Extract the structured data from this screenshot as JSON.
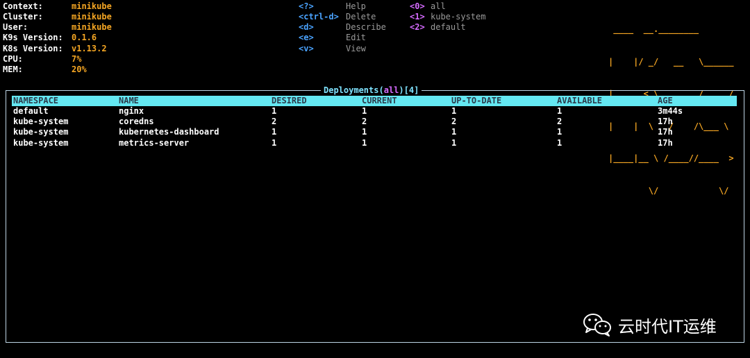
{
  "info": [
    {
      "label": "Context:",
      "value": "minikube"
    },
    {
      "label": "Cluster:",
      "value": "minikube"
    },
    {
      "label": "User:",
      "value": "minikube"
    },
    {
      "label": "K9s Version:",
      "value": "0.1.6"
    },
    {
      "label": "K8s Version:",
      "value": "v1.13.2"
    },
    {
      "label": "CPU:",
      "value": "7%"
    },
    {
      "label": "MEM:",
      "value": "20%"
    }
  ],
  "shortcuts": [
    {
      "key": "<?>",
      "action": "Help"
    },
    {
      "key": "<ctrl-d>",
      "action": "Delete"
    },
    {
      "key": "<d>",
      "action": "Describe"
    },
    {
      "key": "<e>",
      "action": "Edit"
    },
    {
      "key": "<v>",
      "action": "View"
    }
  ],
  "namespaces": [
    {
      "key": "<0>",
      "name": "all"
    },
    {
      "key": "<1>",
      "name": "kube-system"
    },
    {
      "key": "<2>",
      "name": "default"
    }
  ],
  "logo": {
    "line1": " ____  __.________       ",
    "line2": "|    |/ _/   __   \\______",
    "line3": "|      < \\____    /  ___/",
    "line4": "|    |  \\   /    /\\___ \\ ",
    "line5": "|____|__ \\ /____//____  >",
    "line6": "        \\/            \\/ "
  },
  "panel": {
    "title_prefix": "Deployments(",
    "title_scope": "all",
    "title_suffix": ")[4]"
  },
  "table": {
    "headers": [
      "NAMESPACE",
      "NAME",
      "DESIRED",
      "CURRENT",
      "UP-TO-DATE",
      "AVAILABLE",
      "AGE"
    ],
    "rows": [
      [
        "default",
        "nginx",
        "1",
        "1",
        "1",
        "1",
        "3m44s"
      ],
      [
        "kube-system",
        "coredns",
        "2",
        "2",
        "2",
        "2",
        "17h"
      ],
      [
        "kube-system",
        "kubernetes-dashboard",
        "1",
        "1",
        "1",
        "1",
        "17h"
      ],
      [
        "kube-system",
        "metrics-server",
        "1",
        "1",
        "1",
        "1",
        "17h"
      ]
    ]
  },
  "watermark": {
    "text": "云时代IT运维",
    "icon": "wechat-icon"
  },
  "colors": {
    "accent": "#f5a623",
    "header_bg": "#64e8f2",
    "key": "#4aa3ff",
    "namespace_key": "#d66bff",
    "border": "#bfd6e6"
  }
}
